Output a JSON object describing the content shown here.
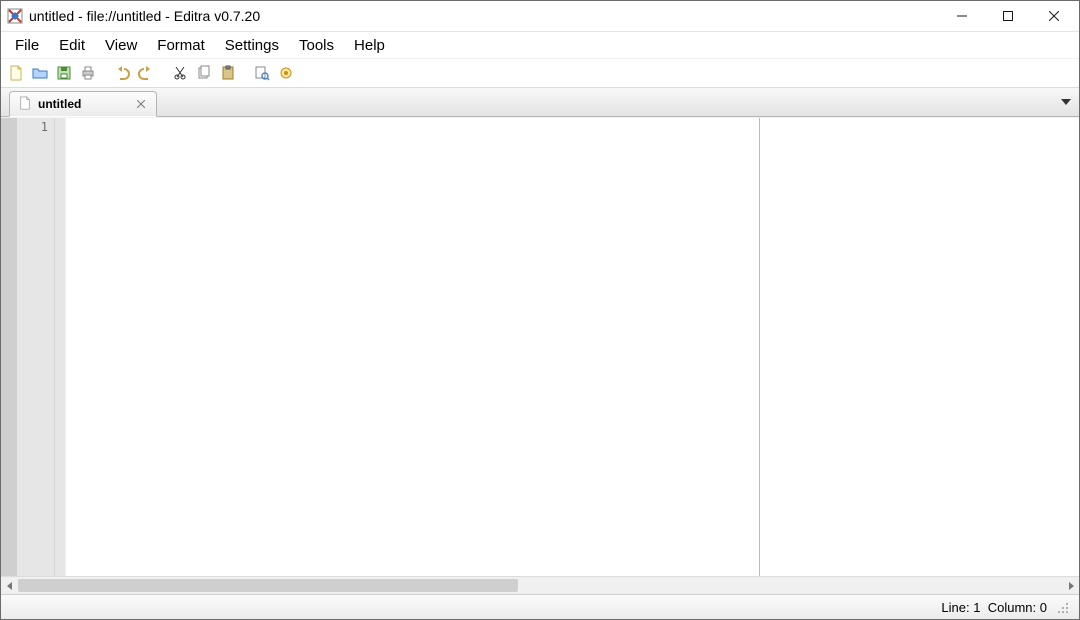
{
  "titlebar": {
    "title": "untitled - file://untitled - Editra v0.7.20"
  },
  "menubar": {
    "items": [
      "File",
      "Edit",
      "View",
      "Format",
      "Settings",
      "Tools",
      "Help"
    ]
  },
  "toolbar": {
    "icons": [
      "new-file-icon",
      "open-file-icon",
      "save-file-icon",
      "print-icon",
      "undo-icon",
      "redo-icon",
      "cut-icon",
      "copy-icon",
      "paste-icon",
      "find-icon",
      "settings-icon"
    ]
  },
  "tabs": {
    "items": [
      {
        "label": "untitled"
      }
    ]
  },
  "editor": {
    "line_numbers": [
      "1"
    ]
  },
  "statusbar": {
    "line_label": "Line:",
    "line_value": "1",
    "column_label": "Column:",
    "column_value": "0"
  }
}
